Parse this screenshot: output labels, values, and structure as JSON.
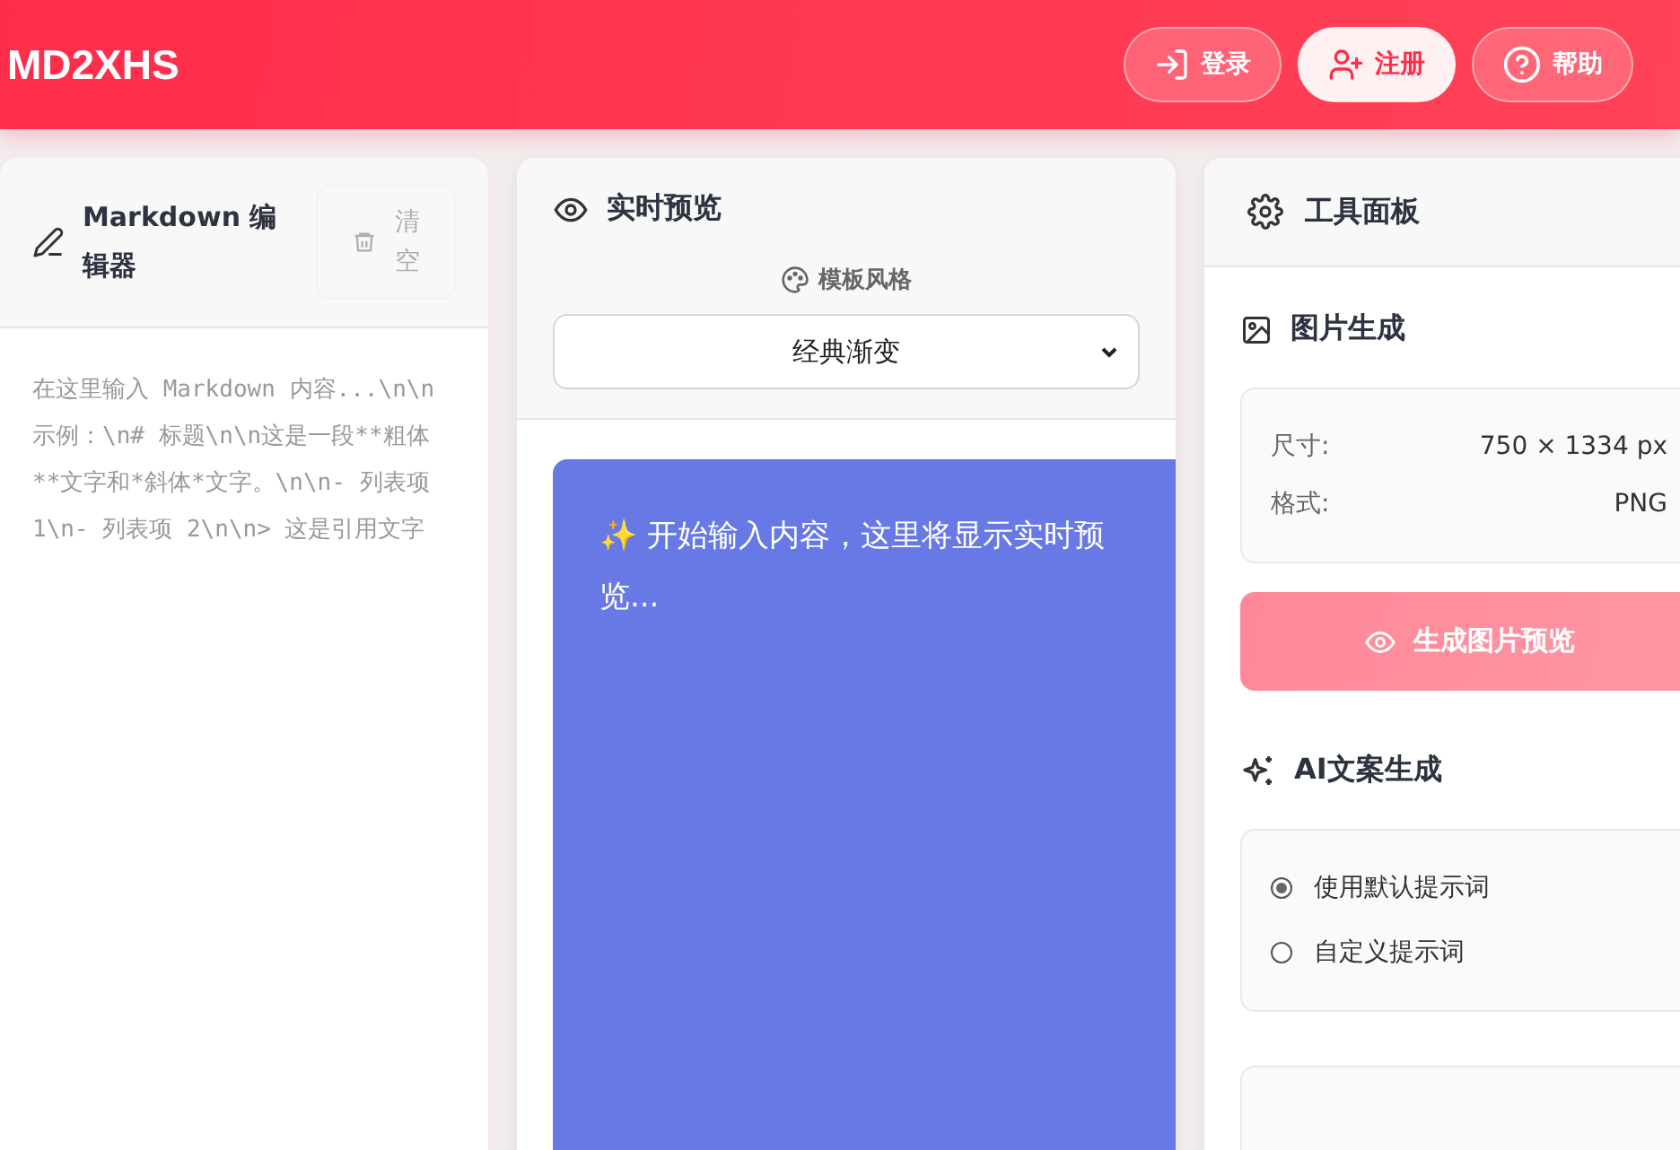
{
  "header": {
    "title": "MD2XHS",
    "buttons": [
      {
        "label": "登录",
        "kind": "outline"
      },
      {
        "label": "注册",
        "kind": "solid"
      },
      {
        "label": "帮助",
        "kind": "outline"
      }
    ]
  },
  "editor": {
    "title": "Markdown 编辑器",
    "clear_button": {
      "label": "清空",
      "disabled": true
    },
    "placeholder": "在这里输入 Markdown 内容...\\n\\n示例：\\n# 标题\\n\\n这是一段**粗体**文字和*斜体*文字。\\n\\n- 列表项 1\\n- 列表项 2\\n\\n> 这是引用文字"
  },
  "preview": {
    "title": "实时预览",
    "template_label": "模板风格",
    "template_value": "经典渐变",
    "message": "✨ 开始输入内容，这里将显示实时预览..."
  },
  "tools": {
    "title": "工具面板",
    "image": {
      "title": "图片生成",
      "specs": [
        {
          "label": "尺寸:",
          "value": "750 × 1334 px"
        },
        {
          "label": "格式:",
          "value": "PNG"
        }
      ],
      "button": {
        "label": "生成图片预览",
        "disabled": true
      }
    },
    "ai": {
      "title": "AI文案生成",
      "options": [
        {
          "label": "使用默认提示词",
          "selected": true
        },
        {
          "label": "自定义提示词",
          "selected": false
        }
      ]
    }
  }
}
